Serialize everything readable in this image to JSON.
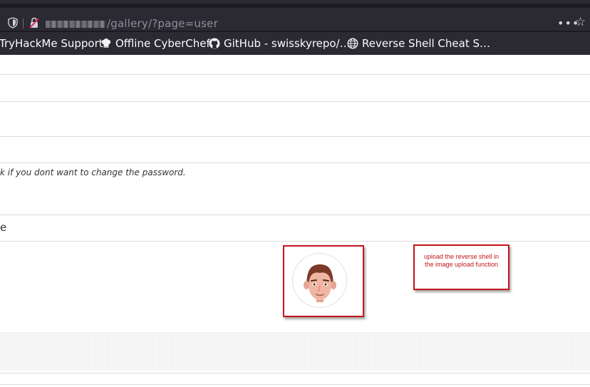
{
  "browser": {
    "url_path": "/gallery/?page=user",
    "menu_dots": "•••",
    "icons": {
      "shield": "shield-icon",
      "lock": "insecure-lock-icon",
      "star": "bookmark-star-icon"
    }
  },
  "bookmarks": [
    {
      "label": "TryHackMe Support",
      "icon": ""
    },
    {
      "label": "Offline CyberChef",
      "icon": "chef-hat-icon"
    },
    {
      "label": "GitHub - swisskyrepo/…",
      "icon": "github-icon"
    },
    {
      "label": "Reverse Shell Cheat S…",
      "icon": "globe-icon"
    }
  ],
  "form": {
    "password_help": "k if you dont want to change the password.",
    "truncated_label": "e"
  },
  "annotation": {
    "text": "upload the reverse shell in the image upload function",
    "color": "#c4161c"
  }
}
